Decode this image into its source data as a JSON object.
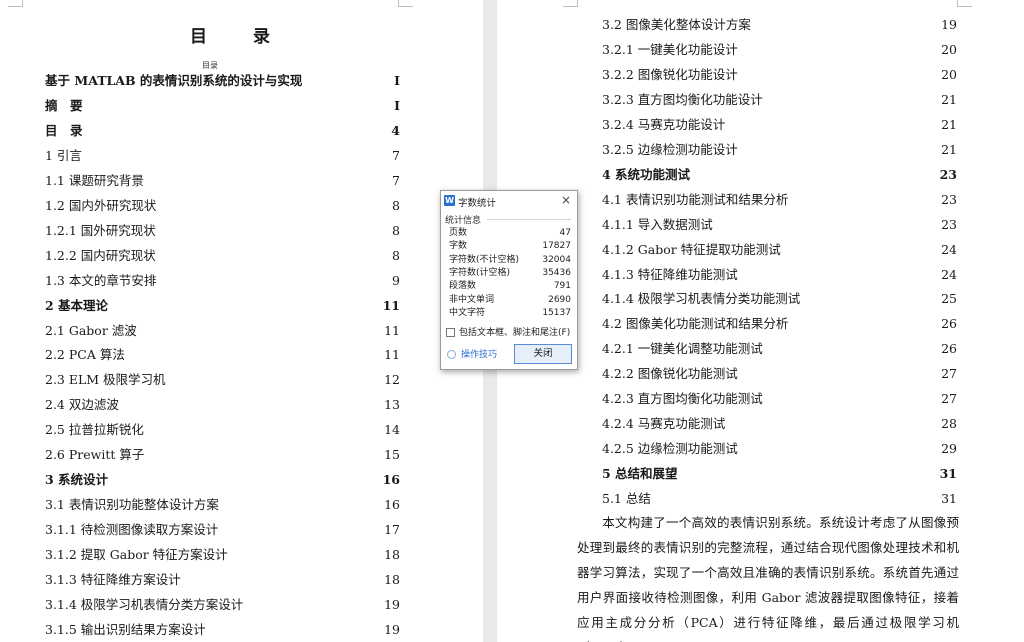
{
  "left_page": {
    "title": "目 录",
    "subtitle": "目录",
    "entries": [
      {
        "text": "基于 MATLAB 的表情识别系统的设计与实现",
        "page": "I"
      },
      {
        "text": "摘　要",
        "page": "I"
      },
      {
        "text": "目　录",
        "page": "4"
      },
      {
        "text": "1 引言",
        "page": "7"
      },
      {
        "text": "1.1  课题研究背景",
        "page": "7"
      },
      {
        "text": "1.2 国内外研究现状",
        "page": "8"
      },
      {
        "text": "1.2.1 国外研究现状",
        "page": "8"
      },
      {
        "text": "1.2.2 国内研究现状",
        "page": "8"
      },
      {
        "text": "1.3 本文的章节安排",
        "page": "9"
      },
      {
        "text": "2 基本理论",
        "page": "11"
      },
      {
        "text": "2.1 Gabor 滤波",
        "page": "11"
      },
      {
        "text": "2.2 PCA 算法",
        "page": "11"
      },
      {
        "text": "2.3 ELM 极限学习机",
        "page": "12"
      },
      {
        "text": "2.4 双边滤波",
        "page": "13"
      },
      {
        "text": "2.5  拉普拉斯锐化",
        "page": "14"
      },
      {
        "text": "2.6 Prewitt 算子",
        "page": "15"
      },
      {
        "text": "3 系统设计",
        "page": "16"
      },
      {
        "text": "3.1  表情识别功能整体设计方案",
        "page": "16"
      },
      {
        "text": "3.1.1  待检测图像读取方案设计",
        "page": "17"
      },
      {
        "text": "3.1.2  提取 Gabor 特征方案设计",
        "page": "18"
      },
      {
        "text": "3.1.3  特征降维方案设计",
        "page": "18"
      },
      {
        "text": "3.1.4  极限学习机表情分类方案设计",
        "page": "19"
      },
      {
        "text": "3.1.5  输出识别结果方案设计",
        "page": "19"
      }
    ]
  },
  "right_page": {
    "entries": [
      {
        "text": "3.2  图像美化整体设计方案",
        "page": "19"
      },
      {
        "text": "3.2.1  一键美化功能设计",
        "page": "20"
      },
      {
        "text": "3.2.2  图像锐化功能设计",
        "page": "20"
      },
      {
        "text": "3.2.3  直方图均衡化功能设计",
        "page": "21"
      },
      {
        "text": "3.2.4  马赛克功能设计",
        "page": "21"
      },
      {
        "text": "3.2.5  边缘检测功能设计",
        "page": "21"
      },
      {
        "text": "4 系统功能测试",
        "page": "23"
      },
      {
        "text": "4.1  表情识别功能测试和结果分析",
        "page": "23"
      },
      {
        "text": "4.1.1 导入数据测试",
        "page": "23"
      },
      {
        "text": "4.1.2 Gabor 特征提取功能测试",
        "page": "24"
      },
      {
        "text": "4.1.3  特征降维功能测试",
        "page": "24"
      },
      {
        "text": "4.1.4  极限学习机表情分类功能测试",
        "page": "25"
      },
      {
        "text": "4.2  图像美化功能测试和结果分析",
        "page": "26"
      },
      {
        "text": "4.2.1 一键美化调整功能测试",
        "page": "26"
      },
      {
        "text": "4.2.2 图像锐化功能测试",
        "page": "27"
      },
      {
        "text": "4.2.3 直方图均衡化功能测试",
        "page": "27"
      },
      {
        "text": "4.2.4 马赛克功能测试",
        "page": "28"
      },
      {
        "text": "4.2.5  边缘检测功能测试",
        "page": "29"
      },
      {
        "text": "5 总结和展望",
        "page": "31"
      },
      {
        "text": "5.1 总结",
        "page": "31"
      }
    ],
    "paragraph": "本文构建了一个高效的表情识别系统。系统设计考虑了从图像预处理到最终的表情识别的完整流程，通过结合现代图像处理技术和机器学习算法，实现了一个高效且准确的表情识别系统。系统首先通过用户界面接收待检测图像，利用 Gabor 滤波器提取图像特征，接着应用主成分分析（PCA）进行特征降维，最后通过极限学习机（ELM）"
  },
  "dialog": {
    "title": "字数统计",
    "app_icon": "W",
    "section_label": "统计信息",
    "stats": [
      {
        "label": "页数",
        "value": "47"
      },
      {
        "label": "字数",
        "value": "17827"
      },
      {
        "label": "字符数(不计空格)",
        "value": "32004"
      },
      {
        "label": "字符数(计空格)",
        "value": "35436"
      },
      {
        "label": "段落数",
        "value": "791"
      },
      {
        "label": "非中文单词",
        "value": "2690"
      },
      {
        "label": "中文字符",
        "value": "15137"
      }
    ],
    "checkbox_label": "包括文本框、脚注和尾注(F)",
    "tips_label": "操作技巧",
    "close_button_label": "关闭",
    "close_icon": "×"
  }
}
